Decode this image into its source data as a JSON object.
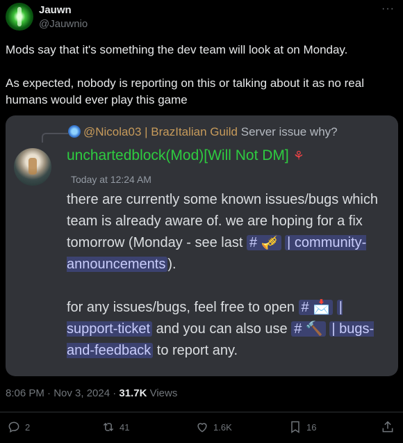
{
  "post": {
    "author_name": "Jauwn",
    "author_handle": "@Jauwnio",
    "more_icon": "···",
    "text_paragraphs": [
      "Mods say that it's something the dev team will look at on Monday.",
      "As expected, nobody is reporting on this or talking about it as no real humans would ever play this game"
    ],
    "timestamp": "8:06 PM · Nov 3, 2024 · ",
    "views_count": "31.7K",
    "views_label": " Views"
  },
  "discord": {
    "reply_author": "@Nicola03 | BrazItalian Guild",
    "reply_text": "Server issue why?",
    "author": "unchartedblock(Mod)[Will Not DM]",
    "time": "Today at 12:24 AM",
    "msg1_part1": "there are currently some known issues/bugs which team is already aware of. we are hoping for a fix tomorrow (Monday - see last ",
    "chan1_icon": "🎺",
    "chan1": "community-announcements",
    "msg1_part2": ").",
    "msg2_part1": "for any issues/bugs, feel free to open ",
    "chan2_icon": "📩",
    "chan2": "support-ticket",
    "msg2_part2": " and you can also use ",
    "chan3_icon": "🔨",
    "chan3": "bugs-and-feedback",
    "msg2_part3": " to report any."
  },
  "actions": {
    "replies": "2",
    "reposts": "41",
    "likes": "1.6K",
    "bookmarks": "16"
  }
}
